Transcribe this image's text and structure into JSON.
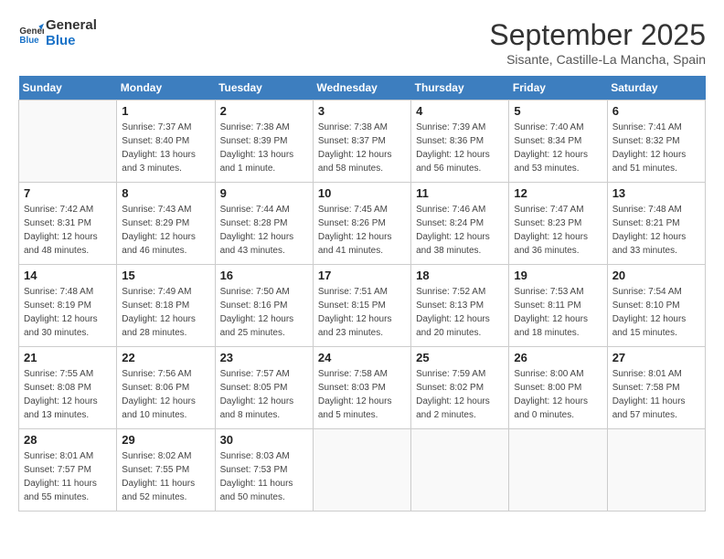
{
  "header": {
    "logo_line1": "General",
    "logo_line2": "Blue",
    "month": "September 2025",
    "location": "Sisante, Castille-La Mancha, Spain"
  },
  "days_of_week": [
    "Sunday",
    "Monday",
    "Tuesday",
    "Wednesday",
    "Thursday",
    "Friday",
    "Saturday"
  ],
  "weeks": [
    [
      {
        "day": "",
        "info": ""
      },
      {
        "day": "1",
        "info": "Sunrise: 7:37 AM\nSunset: 8:40 PM\nDaylight: 13 hours\nand 3 minutes."
      },
      {
        "day": "2",
        "info": "Sunrise: 7:38 AM\nSunset: 8:39 PM\nDaylight: 13 hours\nand 1 minute."
      },
      {
        "day": "3",
        "info": "Sunrise: 7:38 AM\nSunset: 8:37 PM\nDaylight: 12 hours\nand 58 minutes."
      },
      {
        "day": "4",
        "info": "Sunrise: 7:39 AM\nSunset: 8:36 PM\nDaylight: 12 hours\nand 56 minutes."
      },
      {
        "day": "5",
        "info": "Sunrise: 7:40 AM\nSunset: 8:34 PM\nDaylight: 12 hours\nand 53 minutes."
      },
      {
        "day": "6",
        "info": "Sunrise: 7:41 AM\nSunset: 8:32 PM\nDaylight: 12 hours\nand 51 minutes."
      }
    ],
    [
      {
        "day": "7",
        "info": "Sunrise: 7:42 AM\nSunset: 8:31 PM\nDaylight: 12 hours\nand 48 minutes."
      },
      {
        "day": "8",
        "info": "Sunrise: 7:43 AM\nSunset: 8:29 PM\nDaylight: 12 hours\nand 46 minutes."
      },
      {
        "day": "9",
        "info": "Sunrise: 7:44 AM\nSunset: 8:28 PM\nDaylight: 12 hours\nand 43 minutes."
      },
      {
        "day": "10",
        "info": "Sunrise: 7:45 AM\nSunset: 8:26 PM\nDaylight: 12 hours\nand 41 minutes."
      },
      {
        "day": "11",
        "info": "Sunrise: 7:46 AM\nSunset: 8:24 PM\nDaylight: 12 hours\nand 38 minutes."
      },
      {
        "day": "12",
        "info": "Sunrise: 7:47 AM\nSunset: 8:23 PM\nDaylight: 12 hours\nand 36 minutes."
      },
      {
        "day": "13",
        "info": "Sunrise: 7:48 AM\nSunset: 8:21 PM\nDaylight: 12 hours\nand 33 minutes."
      }
    ],
    [
      {
        "day": "14",
        "info": "Sunrise: 7:48 AM\nSunset: 8:19 PM\nDaylight: 12 hours\nand 30 minutes."
      },
      {
        "day": "15",
        "info": "Sunrise: 7:49 AM\nSunset: 8:18 PM\nDaylight: 12 hours\nand 28 minutes."
      },
      {
        "day": "16",
        "info": "Sunrise: 7:50 AM\nSunset: 8:16 PM\nDaylight: 12 hours\nand 25 minutes."
      },
      {
        "day": "17",
        "info": "Sunrise: 7:51 AM\nSunset: 8:15 PM\nDaylight: 12 hours\nand 23 minutes."
      },
      {
        "day": "18",
        "info": "Sunrise: 7:52 AM\nSunset: 8:13 PM\nDaylight: 12 hours\nand 20 minutes."
      },
      {
        "day": "19",
        "info": "Sunrise: 7:53 AM\nSunset: 8:11 PM\nDaylight: 12 hours\nand 18 minutes."
      },
      {
        "day": "20",
        "info": "Sunrise: 7:54 AM\nSunset: 8:10 PM\nDaylight: 12 hours\nand 15 minutes."
      }
    ],
    [
      {
        "day": "21",
        "info": "Sunrise: 7:55 AM\nSunset: 8:08 PM\nDaylight: 12 hours\nand 13 minutes."
      },
      {
        "day": "22",
        "info": "Sunrise: 7:56 AM\nSunset: 8:06 PM\nDaylight: 12 hours\nand 10 minutes."
      },
      {
        "day": "23",
        "info": "Sunrise: 7:57 AM\nSunset: 8:05 PM\nDaylight: 12 hours\nand 8 minutes."
      },
      {
        "day": "24",
        "info": "Sunrise: 7:58 AM\nSunset: 8:03 PM\nDaylight: 12 hours\nand 5 minutes."
      },
      {
        "day": "25",
        "info": "Sunrise: 7:59 AM\nSunset: 8:02 PM\nDaylight: 12 hours\nand 2 minutes."
      },
      {
        "day": "26",
        "info": "Sunrise: 8:00 AM\nSunset: 8:00 PM\nDaylight: 12 hours\nand 0 minutes."
      },
      {
        "day": "27",
        "info": "Sunrise: 8:01 AM\nSunset: 7:58 PM\nDaylight: 11 hours\nand 57 minutes."
      }
    ],
    [
      {
        "day": "28",
        "info": "Sunrise: 8:01 AM\nSunset: 7:57 PM\nDaylight: 11 hours\nand 55 minutes."
      },
      {
        "day": "29",
        "info": "Sunrise: 8:02 AM\nSunset: 7:55 PM\nDaylight: 11 hours\nand 52 minutes."
      },
      {
        "day": "30",
        "info": "Sunrise: 8:03 AM\nSunset: 7:53 PM\nDaylight: 11 hours\nand 50 minutes."
      },
      {
        "day": "",
        "info": ""
      },
      {
        "day": "",
        "info": ""
      },
      {
        "day": "",
        "info": ""
      },
      {
        "day": "",
        "info": ""
      }
    ]
  ]
}
